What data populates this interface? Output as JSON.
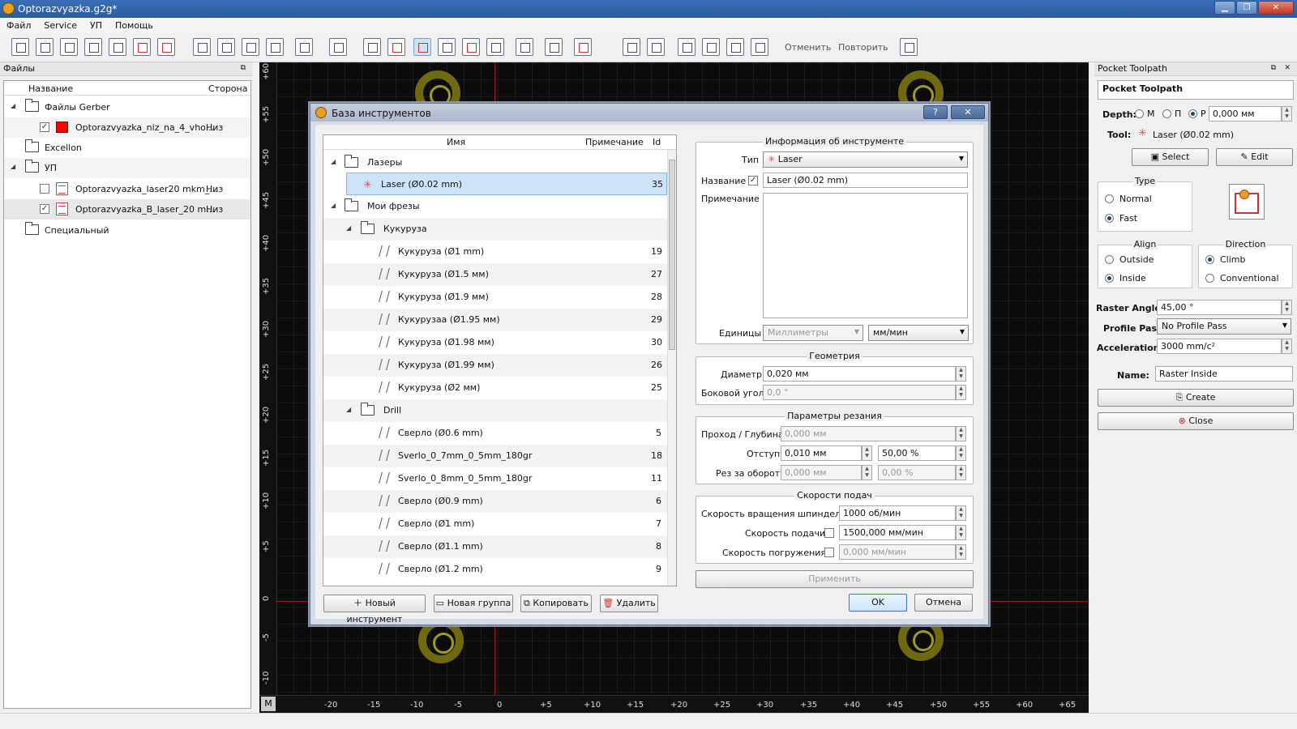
{
  "window": {
    "title": "Optorazvyazka.g2g*"
  },
  "menu": [
    "Файл",
    "Service",
    "УП",
    "Помощь"
  ],
  "toolbar": {
    "undo": "Отменить",
    "redo": "Повторить"
  },
  "left_panel": {
    "title": "Файлы",
    "col_name": "Название",
    "col_side": "Сторона",
    "rows": [
      {
        "label": "Файлы Gerber"
      },
      {
        "label": "Optorazvyazka_niz_na_4_vho...",
        "side": "Низ",
        "checked": true
      },
      {
        "label": "Excellon"
      },
      {
        "label": "УП"
      },
      {
        "label": "Optorazvyazka_laser20 mkm_...",
        "side": "Низ",
        "checked": false
      },
      {
        "label": "Optorazvyazka_B_laser_20 m...",
        "side": "Низ",
        "checked": true
      },
      {
        "label": "Специальный"
      }
    ]
  },
  "canvas": {
    "origin_button": "M",
    "x_ticks": [
      "-20",
      "-15",
      "-10",
      "-5",
      "0",
      "+5",
      "+10",
      "+15",
      "+20",
      "+25",
      "+30",
      "+35",
      "+40",
      "+45",
      "+50",
      "+55",
      "+60",
      "+65"
    ],
    "y_ticks": [
      "+60",
      "+55",
      "+50",
      "+45",
      "+40",
      "+35",
      "+30",
      "+25",
      "+20",
      "+15",
      "+10",
      "+5",
      "0",
      "-5",
      "-10"
    ]
  },
  "dialog": {
    "title": "База инструментов",
    "help": "?",
    "close": "✕",
    "list": {
      "col_name": "Имя",
      "col_note": "Примечание",
      "col_id": "Id",
      "rows": [
        {
          "label": "Лазеры",
          "id": ""
        },
        {
          "label": "Laser (Ø0.02 mm)",
          "id": "35"
        },
        {
          "label": "Мои фрезы",
          "id": ""
        },
        {
          "label": "Кукуруза",
          "id": ""
        },
        {
          "label": "Кукуруза (Ø1 mm)",
          "id": "19"
        },
        {
          "label": "Кукуруза (Ø1.5 мм)",
          "id": "27"
        },
        {
          "label": "Кукуруза (Ø1.9 мм)",
          "id": "28"
        },
        {
          "label": "Кукурузаа (Ø1.95 мм)",
          "id": "29"
        },
        {
          "label": "Кукуруза (Ø1.98 мм)",
          "id": "30"
        },
        {
          "label": "Кукуруза (Ø1.99 мм)",
          "id": "26"
        },
        {
          "label": "Кукуруза (Ø2 мм)",
          "id": "25"
        },
        {
          "label": "Drill",
          "id": ""
        },
        {
          "label": "Сверло (Ø0.6 mm)",
          "id": "5"
        },
        {
          "label": "Sverlo_0_7mm_0_5mm_180gr",
          "id": "18"
        },
        {
          "label": "Sverlo_0_8mm_0_5mm_180gr",
          "id": "11"
        },
        {
          "label": "Сверло (Ø0.9 mm)",
          "id": "6"
        },
        {
          "label": "Сверло (Ø1 mm)",
          "id": "7"
        },
        {
          "label": "Сверло (Ø1.1 mm)",
          "id": "8"
        },
        {
          "label": "Сверло (Ø1.2 mm)",
          "id": "9"
        }
      ]
    },
    "buttons": {
      "new_tool": "Новый инструмент",
      "new_group": "Новая группа",
      "copy": "Копировать",
      "delete": "Удалить",
      "ok": "OK",
      "cancel": "Отмена",
      "apply": "Применить"
    },
    "info": {
      "title": "Информация об инструменте",
      "type_label": "Тип",
      "type_value": "Laser",
      "name_label": "Название",
      "name_value": "Laser (Ø0.02 mm)",
      "note_label": "Примечание",
      "units_label": "Единицы",
      "units_value": "Миллиметры",
      "units_speed": "мм/мин"
    },
    "geometry": {
      "title": "Геометрия",
      "diameter_label": "Диаметр",
      "diameter_value": "0,020 мм",
      "angle_label": "Боковой угол",
      "angle_value": "0,0 °"
    },
    "cutting": {
      "title": "Параметры резания",
      "depth_label": "Проход / Глубина",
      "depth_value": "0,000 мм",
      "stepover_label": "Отступ",
      "stepover_value": "0,010 мм",
      "stepover_pct": "50,00 %",
      "feed_rev_label": "Рез за оборот",
      "feed_rev_value": "0,000 мм",
      "feed_rev_pct": "0,00 %"
    },
    "feeds": {
      "title": "Скорости подач",
      "spindle_label": "Скорость вращения шпинделя",
      "spindle_value": "1000 об/мин",
      "feed_label": "Скорость подачи",
      "feed_value": "1500,000 мм/мин",
      "plunge_label": "Скорость погружения",
      "plunge_value": "0,000 мм/мин"
    }
  },
  "right_panel": {
    "title": "Pocket Toolpath",
    "header": "Pocket Toolpath",
    "depth_label": "Depth:",
    "depth_opts": [
      "M",
      "П",
      "P"
    ],
    "depth_value": "0,000 мм",
    "tool_label": "Tool:",
    "tool_value": "Laser (Ø0.02 mm)",
    "select": "Select",
    "edit": "Edit",
    "type_title": "Type",
    "type_opts": [
      "Normal",
      "Fast"
    ],
    "align_title": "Align",
    "align_opts": [
      "Outside",
      "Inside"
    ],
    "direction_title": "Direction",
    "direction_opts": [
      "Climb",
      "Conventional"
    ],
    "raster_label": "Raster Angle:",
    "raster_value": "45,00 °",
    "profile_label": "Profile Pass:",
    "profile_value": "No Profile Pass",
    "accel_label": "Acceleration:",
    "accel_value": "3000 mm/c²",
    "name_label": "Name:",
    "name_value": "Raster Inside",
    "create": "Create",
    "close": "Close"
  },
  "colors": {
    "accent": "#2b5aa0",
    "canvas_bg": "#0c0c0c",
    "pad": "#a09a20"
  }
}
